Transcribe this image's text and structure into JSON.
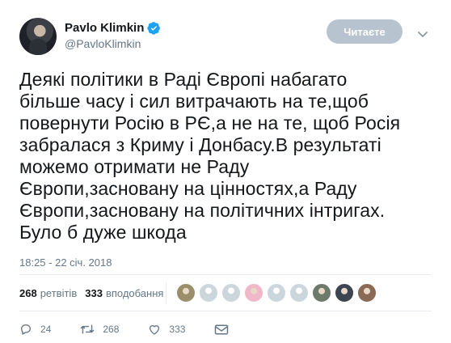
{
  "user": {
    "display_name": "Pavlo Klimkin",
    "handle": "@PavloKlimkin",
    "verified": true
  },
  "follow_button": {
    "label": "Читаєте"
  },
  "tweet": {
    "text": "Деякі політики в Раді Європі набагато\nбільше часу і сил витрачають на те,щоб\nповернути Росію в РЄ,а не на те, щоб Росія\nзабралася з Криму і Донбасу.В результаті\nможемо отримати не Раду\nЄвропи,засновану на цінностях,а Раду\nЄвропи,засновану на політичних інтригах.\nБуло б дуже шкода",
    "timestamp": "18:25 - 22 січ. 2018"
  },
  "stats": {
    "retweets_count": "268",
    "retweets_label": "ретвітів",
    "likes_count": "333",
    "likes_label": "вподобання"
  },
  "likers": [
    {
      "icon": "avatar-image",
      "color": "#9a8f6a"
    },
    {
      "icon": "avatar-default-icon",
      "color": "#ccd6dd"
    },
    {
      "icon": "avatar-default-icon",
      "color": "#ccd6dd"
    },
    {
      "icon": "avatar-image",
      "color": "#f0b8c8"
    },
    {
      "icon": "avatar-default-icon",
      "color": "#ccd6dd"
    },
    {
      "icon": "avatar-default-icon",
      "color": "#ccd6dd"
    },
    {
      "icon": "avatar-image",
      "color": "#6d7a6a"
    },
    {
      "icon": "avatar-image",
      "color": "#3d4650"
    },
    {
      "icon": "avatar-image",
      "color": "#8a6a55"
    }
  ],
  "actions": {
    "replies": "24",
    "retweets": "268",
    "likes": "333"
  },
  "colors": {
    "text": "#14171a",
    "secondary": "#657786",
    "verified": "#1da1f2",
    "button": "#b7c4cf"
  }
}
